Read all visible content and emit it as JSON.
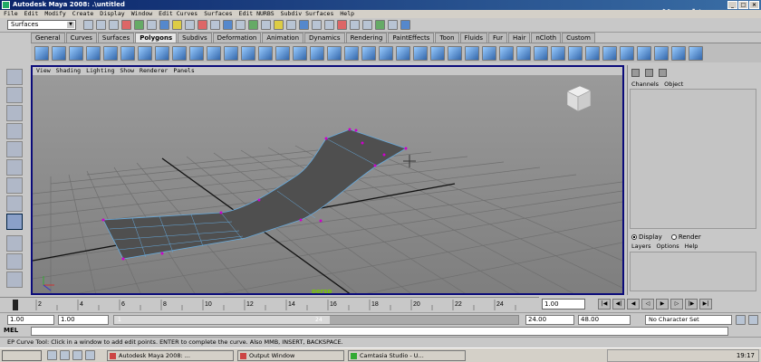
{
  "window": {
    "title": "Autodesk Maya 2008: .\\untitled"
  },
  "menubar": [
    "File",
    "Edit",
    "Modify",
    "Create",
    "Display",
    "Window",
    "Edit Curves",
    "Surfaces",
    "Edit NURBS",
    "Subdiv Surfaces",
    "Help"
  ],
  "status": {
    "mode": "Surfaces"
  },
  "shelf_tabs": [
    "General",
    "Curves",
    "Surfaces",
    "Polygons",
    "Subdivs",
    "Deformation",
    "Animation",
    "Dynamics",
    "Rendering",
    "PaintEffects",
    "Toon",
    "Fluids",
    "Fur",
    "Hair",
    "nCloth",
    "Custom"
  ],
  "active_shelf_tab": "Polygons",
  "viewport": {
    "menu": [
      "View",
      "Shading",
      "Lighting",
      "Show",
      "Renderer",
      "Panels"
    ],
    "camera": "persp"
  },
  "right_panel": {
    "channel_menu": [
      "Channels",
      "Object"
    ],
    "display_label": "Display",
    "render_label": "Render",
    "layer_menu": [
      "Layers",
      "Options",
      "Help"
    ]
  },
  "timeline": {
    "ticks": [
      "2",
      "4",
      "6",
      "8",
      "10",
      "12",
      "14",
      "16",
      "18",
      "20",
      "22",
      "24"
    ],
    "current_frame": "1.00"
  },
  "range": {
    "start": "1.00",
    "min": "1.00",
    "range_start_label": "1",
    "range_end_label": "24",
    "end": "24.00",
    "max": "48.00",
    "character_set": "No Character Set"
  },
  "mel": {
    "label": "MEL"
  },
  "help_line": "EP Curve Tool: Click in a window to add edit points. ENTER to complete the curve. Also MMB, INSERT, BACKSPACE.",
  "taskbar": {
    "items": [
      "Autodesk Maya 2008: ...",
      "Output Window",
      "Camtasia Studio - U..."
    ],
    "clock": "19:17"
  }
}
